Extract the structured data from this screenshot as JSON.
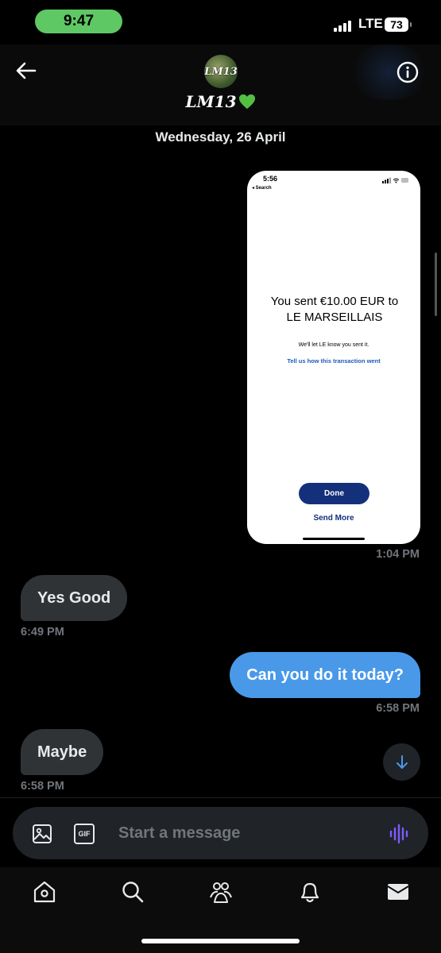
{
  "status_bar": {
    "time": "9:47",
    "network": "LTE",
    "battery": "73"
  },
  "header": {
    "avatar_text": "LM13",
    "contact_name": "LM13"
  },
  "date_separator": "Wednesday, 26 April",
  "image_message": {
    "screenshot": {
      "time": "5:56",
      "back_label": "◂ Search",
      "headline": "You sent €10.00 EUR to LE MARSEILLAIS",
      "subtext": "We'll let LE know you sent it.",
      "link": "Tell us how this transaction went",
      "done_label": "Done",
      "send_more_label": "Send More"
    },
    "timestamp": "1:04 PM"
  },
  "messages": [
    {
      "direction": "in",
      "text": "Yes Good",
      "timestamp": "6:49 PM"
    },
    {
      "direction": "out",
      "text": "Can you do it today?",
      "timestamp": "6:58 PM"
    },
    {
      "direction": "in",
      "text": "Maybe",
      "timestamp": "6:58 PM"
    }
  ],
  "composer": {
    "placeholder": "Start a message",
    "gif_label": "GIF",
    "icons": [
      "image-icon",
      "gif-icon",
      "voice-icon"
    ]
  },
  "bottom_nav": [
    "home-icon",
    "search-icon",
    "communities-icon",
    "notifications-icon",
    "messages-icon"
  ],
  "colors": {
    "accent": "#4a99e9",
    "incoming_bubble": "#2f3336",
    "muted_text": "#71767b",
    "voice_icon": "#7c5cff",
    "status_pill": "#5ec864"
  }
}
